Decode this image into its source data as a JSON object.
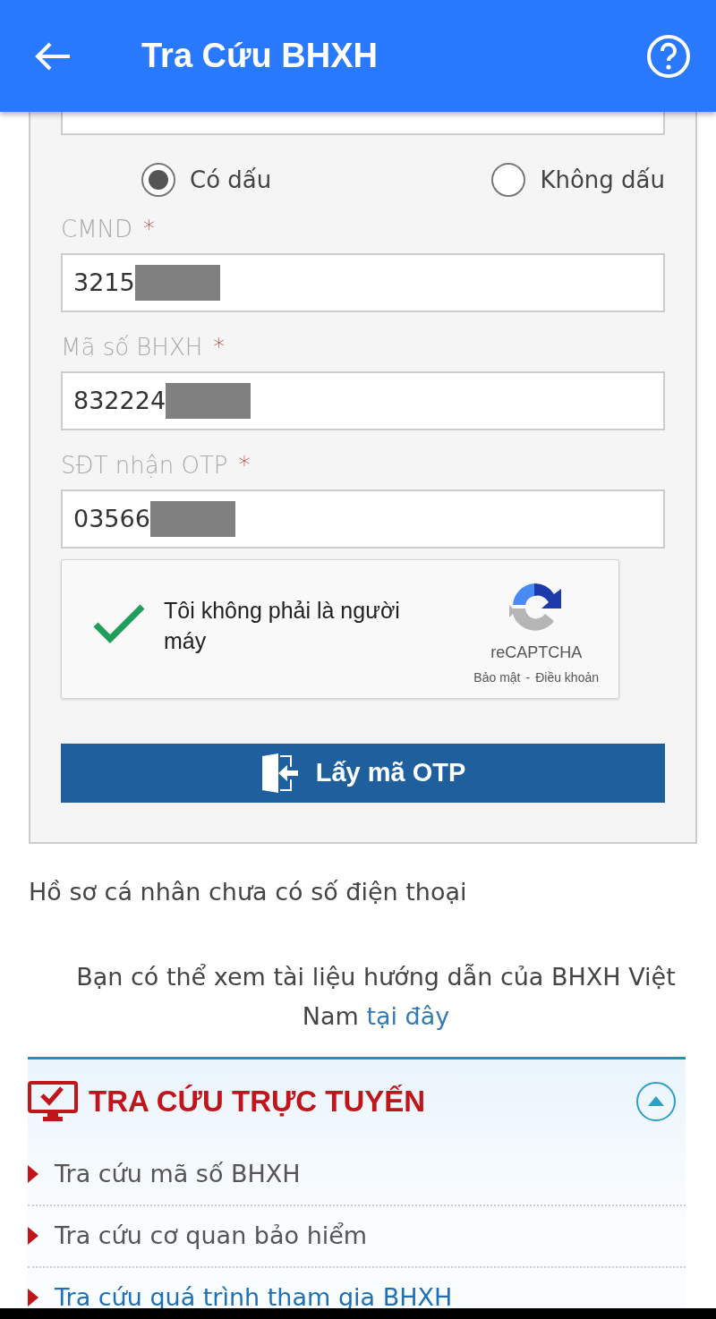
{
  "app_bar": {
    "title": "Tra Cứu BHXH"
  },
  "form": {
    "script_options": [
      {
        "label": "Có dấu",
        "selected": true
      },
      {
        "label": "Không dấu",
        "selected": false
      }
    ],
    "fields": [
      {
        "label": "CMND",
        "required_mark": "*",
        "value": "3215",
        "redacted": true
      },
      {
        "label": "Mã số BHXH",
        "required_mark": "*",
        "value": "832224",
        "redacted": true
      },
      {
        "label": "SĐT nhận OTP",
        "required_mark": "*",
        "value": "03566",
        "redacted": true
      }
    ],
    "captcha": {
      "label": "Tôi không phải là người máy",
      "checked": true,
      "brand": "reCAPTCHA",
      "privacy_link": "Bảo mật",
      "separator": "-",
      "terms_link": "Điều khoản"
    },
    "submit_button": "Lấy mã OTP"
  },
  "notice": "Hồ sơ cá nhân chưa có số điện thoại",
  "guide": {
    "text": "Bạn có thể xem tài liệu hướng dẫn của BHXH Việt Nam",
    "link": "tại đây"
  },
  "section": {
    "title": "TRA CỨU TRỰC TUYẾN",
    "expanded": true,
    "items": [
      {
        "label": "Tra cứu mã số BHXH",
        "selected": false
      },
      {
        "label": "Tra cứu cơ quan bảo hiểm",
        "selected": false
      },
      {
        "label": "Tra cứu quá trình tham gia BHXH",
        "selected": true
      }
    ]
  }
}
